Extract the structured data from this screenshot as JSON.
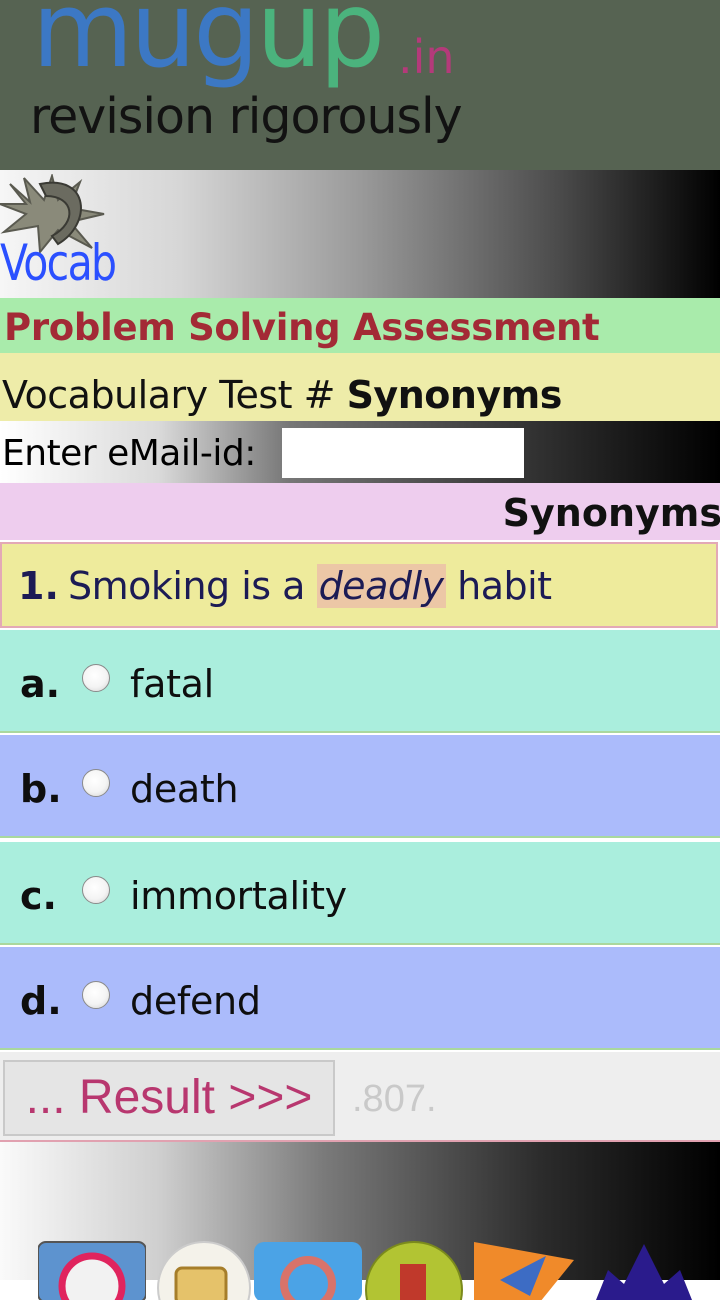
{
  "header": {
    "logo_mug": "mug",
    "logo_up": "up",
    "logo_in": ".in",
    "tagline": "revision rigorously"
  },
  "vocab": {
    "label": "Vocab"
  },
  "assessment": {
    "title": "Problem Solving Assessment"
  },
  "test": {
    "prefix": "Vocabulary Test #",
    "name": "Synonyms"
  },
  "email": {
    "label": "Enter eMail-id:",
    "value": ""
  },
  "section": {
    "title": "Synonyms"
  },
  "question": {
    "number": "1.",
    "before": "Smoking is a",
    "keyword": "deadly",
    "after": "habit"
  },
  "options": [
    {
      "letter": "a.",
      "text": "fatal"
    },
    {
      "letter": "b.",
      "text": "death"
    },
    {
      "letter": "c.",
      "text": "immortality"
    },
    {
      "letter": "d.",
      "text": "defend"
    }
  ],
  "result": {
    "button_label": "... Result >>>",
    "code": ".807."
  },
  "footer": {
    "apps": [
      "target-app-icon",
      "scroll-app-icon",
      "at-symbol-app-icon",
      "globe-app-icon",
      "plane-app-icon",
      "crown-app-icon"
    ]
  }
}
